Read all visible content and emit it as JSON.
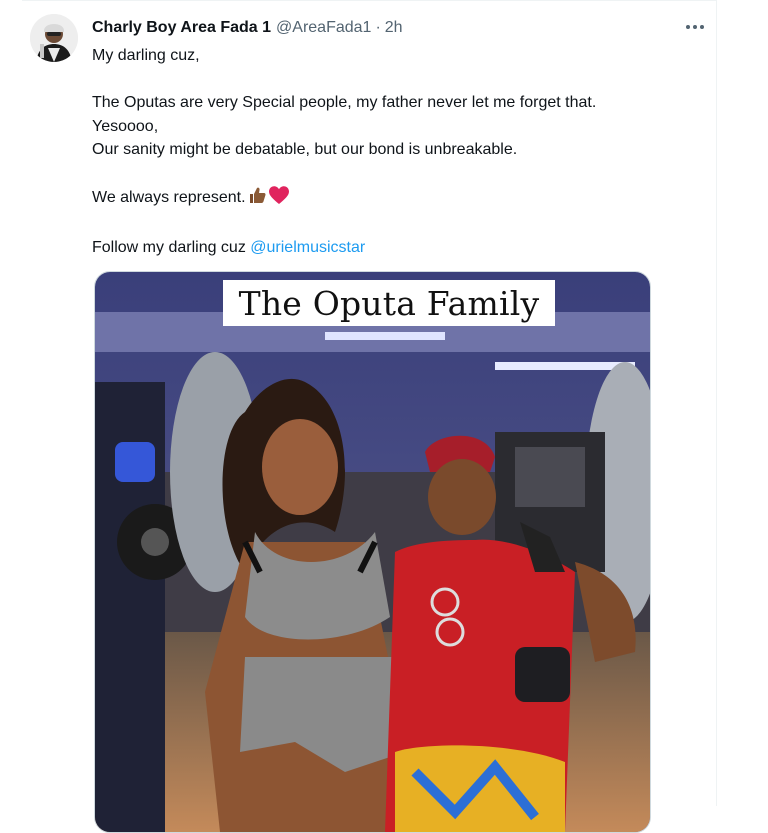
{
  "tweet": {
    "display_name": "Charly Boy Area Fada 1",
    "handle": "@AreaFada1",
    "separator": "·",
    "time": "2h",
    "lines": [
      "My darling cuz,",
      "",
      "The Oputas are very Special people, my father never let me forget that.",
      "Yesoooo,",
      "Our sanity might be debatable, but our bond is unbreakable.",
      "",
      "We always represent.",
      "",
      "Follow my darling cuz"
    ],
    "mention": "@urielmusicstar",
    "emoji_icons": [
      "thumbs-up-icon",
      "red-heart-icon"
    ]
  },
  "media": {
    "caption": "The Oputa Family"
  },
  "colors": {
    "text": "#0f1419",
    "secondary": "#536471",
    "link": "#1d9bf0",
    "border": "#cfd9de"
  }
}
